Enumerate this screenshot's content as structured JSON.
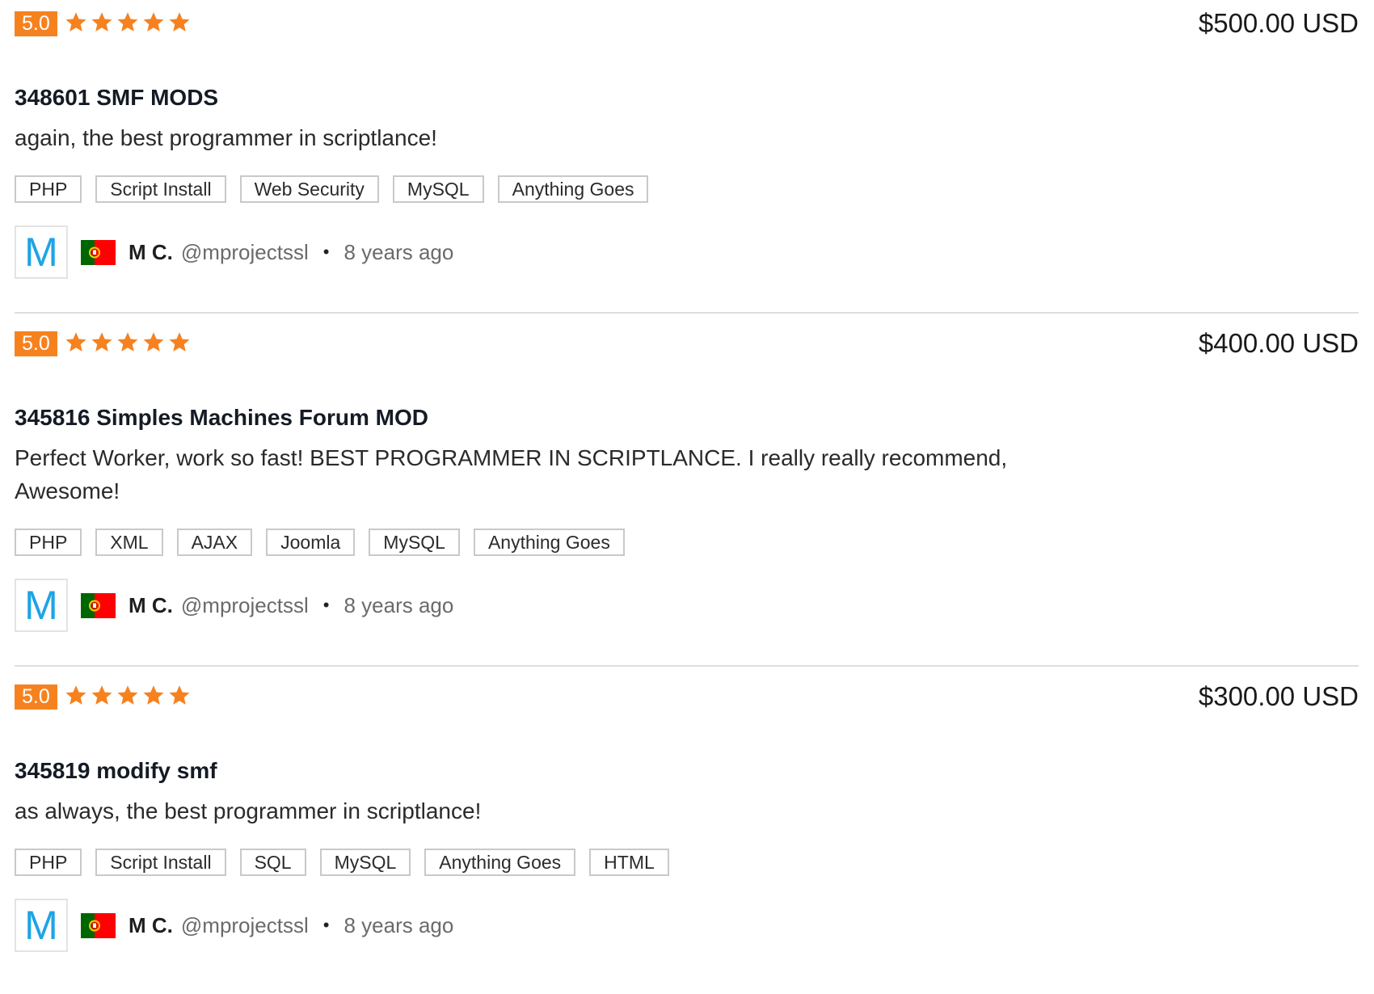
{
  "colors": {
    "accent": "#f6821f",
    "avatar_letter": "#1ea4e4",
    "flag_green": "#006600",
    "flag_red": "#ff0000",
    "flag_yellow": "#ffcc00"
  },
  "icons": {
    "star": "star-icon",
    "flag": "portugal-flag-icon"
  },
  "reviews": [
    {
      "rating": "5.0",
      "stars": 5,
      "price": "$500.00 USD",
      "title": "348601 SMF MODS",
      "comment": "again, the best programmer in scriptlance!",
      "tags": [
        "PHP",
        "Script Install",
        "Web Security",
        "MySQL",
        "Anything Goes"
      ],
      "avatar_letter": "M",
      "name": "M C.",
      "username": "@mprojectssl",
      "separator": "•",
      "time": "8 years ago"
    },
    {
      "rating": "5.0",
      "stars": 5,
      "price": "$400.00 USD",
      "title": "345816 Simples Machines Forum MOD",
      "comment": "Perfect Worker, work so fast! BEST PROGRAMMER IN SCRIPTLANCE. I really really recommend, Awesome!",
      "tags": [
        "PHP",
        "XML",
        "AJAX",
        "Joomla",
        "MySQL",
        "Anything Goes"
      ],
      "avatar_letter": "M",
      "name": "M C.",
      "username": "@mprojectssl",
      "separator": "•",
      "time": "8 years ago"
    },
    {
      "rating": "5.0",
      "stars": 5,
      "price": "$300.00 USD",
      "title": "345819 modify smf",
      "comment": "as always, the best programmer in scriptlance!",
      "tags": [
        "PHP",
        "Script Install",
        "SQL",
        "MySQL",
        "Anything Goes",
        "HTML"
      ],
      "avatar_letter": "M",
      "name": "M C.",
      "username": "@mprojectssl",
      "separator": "•",
      "time": "8 years ago"
    }
  ]
}
